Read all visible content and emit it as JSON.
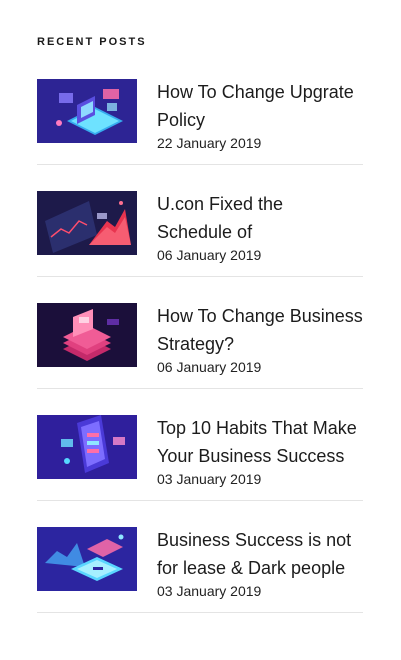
{
  "widget": {
    "title": "RECENT POSTS"
  },
  "posts": [
    {
      "title": "How To Change Upgrate Policy",
      "date": "22 January 2019",
      "thumb_icon": "isometric-laptop-analytics-illustration",
      "thumb_bg": "#2d2494"
    },
    {
      "title": "U.con Fixed the Schedule of",
      "date": "06 January 2019",
      "thumb_icon": "isometric-chart-dashboard-illustration",
      "thumb_bg": "#1d1a4a"
    },
    {
      "title": "How To Change Business Strategy?",
      "date": "06 January 2019",
      "thumb_icon": "isometric-stacked-layers-illustration",
      "thumb_bg": "#1b0f3a"
    },
    {
      "title": "Top 10 Habits That Make Your Business Success",
      "date": "03 January 2019",
      "thumb_icon": "isometric-mobile-app-illustration",
      "thumb_bg": "#2f1f9c"
    },
    {
      "title": "Business Success is not for lease & Dark people",
      "date": "03 January 2019",
      "thumb_icon": "isometric-finance-cards-illustration",
      "thumb_bg": "#2c25a0"
    }
  ]
}
